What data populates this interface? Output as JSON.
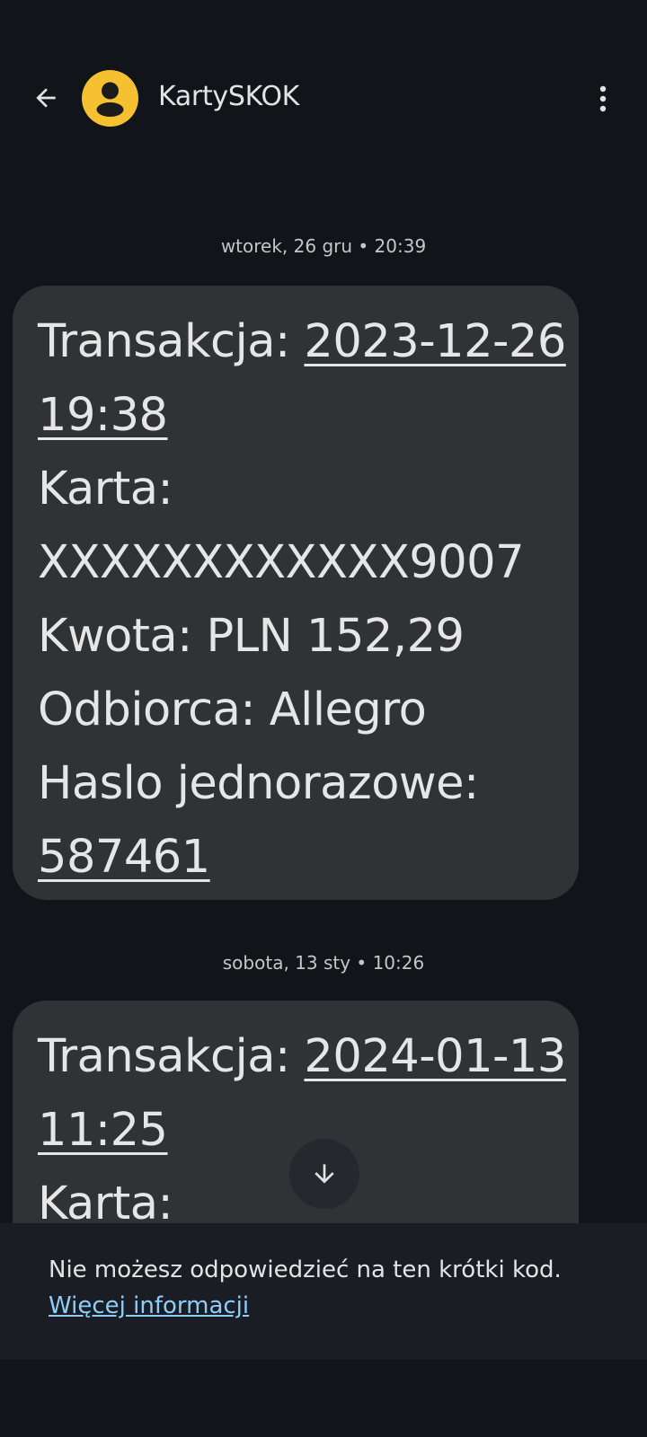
{
  "header": {
    "contact_name": "KartySKOK"
  },
  "messages": [
    {
      "timestamp": "wtorek, 26 gru • 20:39",
      "lines": [
        {
          "label": "Transakcja: ",
          "link": "2023-12-26"
        },
        {
          "label": "",
          "link": "19:38"
        },
        {
          "label": "Karta:",
          "link": ""
        },
        {
          "label": "XXXXXXXXXXXX9007",
          "link": ""
        },
        {
          "label": "Kwota: PLN 152,29",
          "link": ""
        },
        {
          "label": "Odbiorca: Allegro",
          "link": ""
        },
        {
          "label": "Haslo jednorazowe:",
          "link": ""
        },
        {
          "label": "",
          "link": "587461"
        }
      ]
    },
    {
      "timestamp": "sobota, 13 sty • 10:26",
      "lines": [
        {
          "label": "Transakcja: ",
          "link": "2024-01-13"
        },
        {
          "label": "",
          "link": "11:25"
        },
        {
          "label": "Karta:",
          "link": ""
        }
      ]
    }
  ],
  "footer": {
    "notice": "Nie możesz odpowiedzieć na ten krótki kod.",
    "more_info": "Więcej informacji"
  },
  "icons": {
    "back": "arrow-left-icon",
    "avatar": "person-icon",
    "more": "more-vert-icon",
    "scroll": "arrow-down-icon"
  },
  "colors": {
    "background": "#111418",
    "bubble": "#303336",
    "avatar": "#f6c131",
    "link": "#8ecdf8"
  }
}
